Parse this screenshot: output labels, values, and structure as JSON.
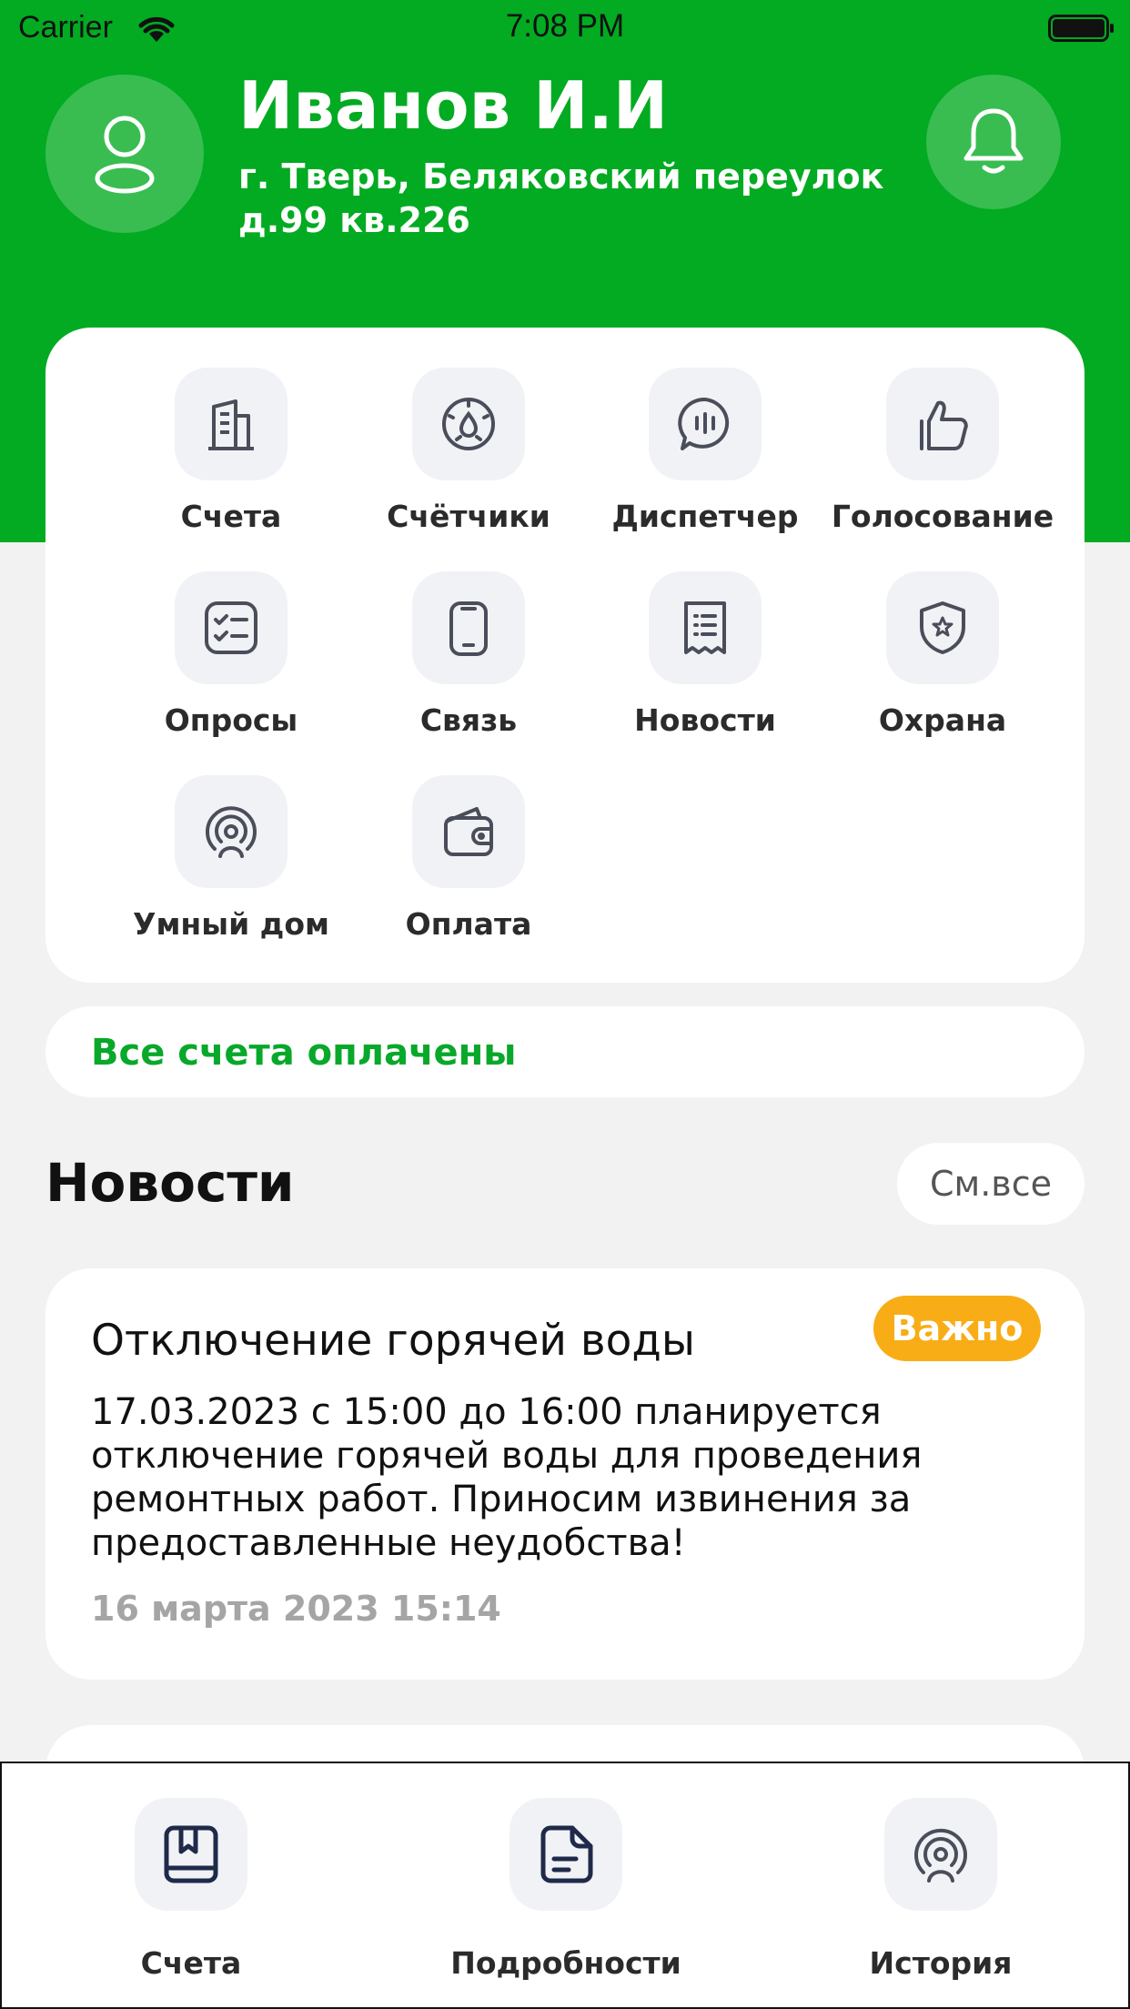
{
  "status_bar": {
    "carrier": "Carrier",
    "time": "7:08 PM"
  },
  "profile": {
    "name": "Иванов И.И",
    "address": "г. Тверь, Беляковский переулок д.99 кв.226"
  },
  "services": [
    {
      "label": "Счета",
      "icon": "building-icon"
    },
    {
      "label": "Счётчики",
      "icon": "meter-icon"
    },
    {
      "label": "Диспетчер",
      "icon": "chat-icon"
    },
    {
      "label": "Голосование",
      "icon": "thumbs-up-icon"
    },
    {
      "label": "Опросы",
      "icon": "checklist-icon"
    },
    {
      "label": "Связь",
      "icon": "phone-icon"
    },
    {
      "label": "Новости",
      "icon": "receipt-icon"
    },
    {
      "label": "Охрана",
      "icon": "shield-icon"
    },
    {
      "label": "Умный дом",
      "icon": "smart-home-icon"
    },
    {
      "label": "Оплата",
      "icon": "wallet-icon"
    }
  ],
  "payment_status": "Все счета оплачены",
  "news": {
    "title": "Новости",
    "see_all": "См.все",
    "items": [
      {
        "headline": "Отключение горячей воды",
        "badge": "Важно",
        "body": "17.03.2023 с 15:00 до 16:00 планируется отключение горячей воды для проведения ремонтных работ. Приносим извинения за предоставленные неудобства!",
        "date": "16 марта 2023 15:14"
      }
    ]
  },
  "tab_bar": [
    {
      "label": "Счета",
      "icon": "book-icon"
    },
    {
      "label": "Подробности",
      "icon": "document-icon"
    },
    {
      "label": "История",
      "icon": "broadcast-icon"
    }
  ],
  "colors": {
    "brand_green": "#02ab21",
    "badge_orange": "#f8ad16",
    "icon_stroke": "#4a4e5a"
  }
}
